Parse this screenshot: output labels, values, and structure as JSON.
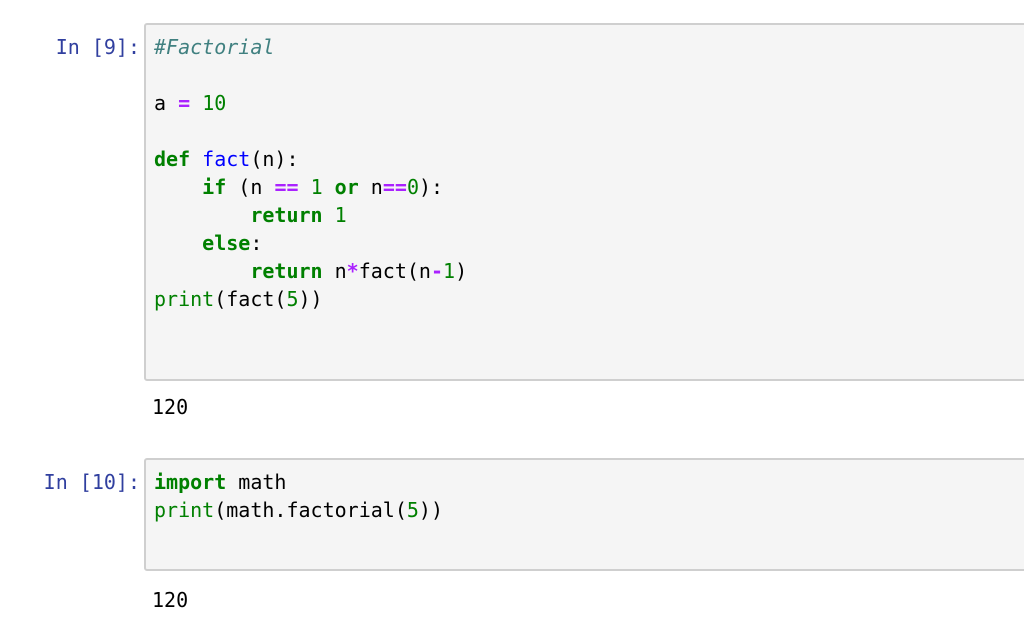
{
  "cells": [
    {
      "prompt": "In [9]:",
      "code_lines": [
        [
          {
            "t": "#Factorial",
            "c": "cm"
          }
        ],
        [],
        [
          {
            "t": "a ",
            "c": "nm"
          },
          {
            "t": "=",
            "c": "op"
          },
          {
            "t": " ",
            "c": "nm"
          },
          {
            "t": "10",
            "c": "num"
          }
        ],
        [],
        [
          {
            "t": "def",
            "c": "kw"
          },
          {
            "t": " ",
            "c": "nm"
          },
          {
            "t": "fact",
            "c": "fn"
          },
          {
            "t": "(n):",
            "c": "nm"
          }
        ],
        [
          {
            "t": "    ",
            "c": "nm"
          },
          {
            "t": "if",
            "c": "kw"
          },
          {
            "t": " (n ",
            "c": "nm"
          },
          {
            "t": "==",
            "c": "op"
          },
          {
            "t": " ",
            "c": "nm"
          },
          {
            "t": "1",
            "c": "num"
          },
          {
            "t": " ",
            "c": "nm"
          },
          {
            "t": "or",
            "c": "kw"
          },
          {
            "t": " n",
            "c": "nm"
          },
          {
            "t": "==",
            "c": "op"
          },
          {
            "t": "0",
            "c": "num"
          },
          {
            "t": "):",
            "c": "nm"
          }
        ],
        [
          {
            "t": "        ",
            "c": "nm"
          },
          {
            "t": "return",
            "c": "kw"
          },
          {
            "t": " ",
            "c": "nm"
          },
          {
            "t": "1",
            "c": "num"
          }
        ],
        [
          {
            "t": "    ",
            "c": "nm"
          },
          {
            "t": "else",
            "c": "kw"
          },
          {
            "t": ":",
            "c": "nm"
          }
        ],
        [
          {
            "t": "        ",
            "c": "nm"
          },
          {
            "t": "return",
            "c": "kw"
          },
          {
            "t": " n",
            "c": "nm"
          },
          {
            "t": "*",
            "c": "op"
          },
          {
            "t": "fact(n",
            "c": "nm"
          },
          {
            "t": "-",
            "c": "op"
          },
          {
            "t": "1",
            "c": "num"
          },
          {
            "t": ")",
            "c": "nm"
          }
        ],
        [
          {
            "t": "print",
            "c": "nb"
          },
          {
            "t": "(fact(",
            "c": "nm"
          },
          {
            "t": "5",
            "c": "num"
          },
          {
            "t": "))",
            "c": "nm"
          }
        ]
      ],
      "output": "120"
    },
    {
      "prompt": "In [10]:",
      "code_lines": [
        [
          {
            "t": "import",
            "c": "kw"
          },
          {
            "t": " math",
            "c": "nm"
          }
        ],
        [
          {
            "t": "print",
            "c": "nb"
          },
          {
            "t": "(math.factorial(",
            "c": "nm"
          },
          {
            "t": "5",
            "c": "num"
          },
          {
            "t": "))",
            "c": "nm"
          }
        ]
      ],
      "output": "120"
    }
  ]
}
